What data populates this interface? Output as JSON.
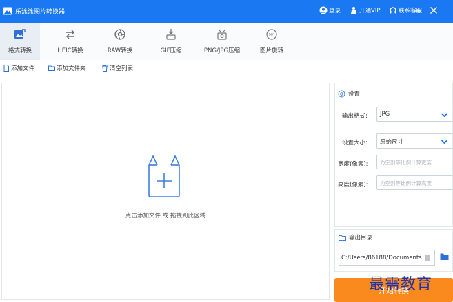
{
  "window": {
    "title": "乐涂涂图片转换器",
    "login_label": "登录",
    "vip_label": "开通VIP",
    "support_label": "联系客服"
  },
  "tabs": [
    {
      "label": "格式转换",
      "icon": "image-convert-icon",
      "active": true
    },
    {
      "label": "HEIC转换",
      "icon": "swap-arrows-icon",
      "active": false
    },
    {
      "label": "RAW转换",
      "icon": "camera-aperture-icon",
      "active": false
    },
    {
      "label": "GIF压缩",
      "icon": "gif-compress-icon",
      "active": false
    },
    {
      "label": "PNG/JPG压缩",
      "icon": "image-compress-icon",
      "active": false
    },
    {
      "label": "图片旋转",
      "icon": "rotate-icon",
      "active": false
    }
  ],
  "actions": {
    "add_file": "添加文件",
    "add_folder": "添加文件夹",
    "clear_list": "清空列表"
  },
  "drop_area": {
    "hint": "点击添加文件 或 拖拽到此区域"
  },
  "settings": {
    "title": "设置",
    "format_label": "输出格式:",
    "format_value": "JPG",
    "size_label": "设置大小:",
    "size_value": "原始尺寸",
    "width_label": "宽度(像素):",
    "width_placeholder": "为空则等比例计算宽度",
    "height_label": "高度(像素):",
    "height_placeholder": "为空则等比例计算高度"
  },
  "output": {
    "title": "输出目录",
    "path": "C:/Users/86188/Documents"
  },
  "start_button": {
    "label": "开始转换"
  },
  "watermark": "最需教育",
  "colors": {
    "titlebar": "#1a78f2",
    "accent": "#1a78f2",
    "start_button": "#fb8a1e",
    "watermark": "#1f33b0"
  }
}
